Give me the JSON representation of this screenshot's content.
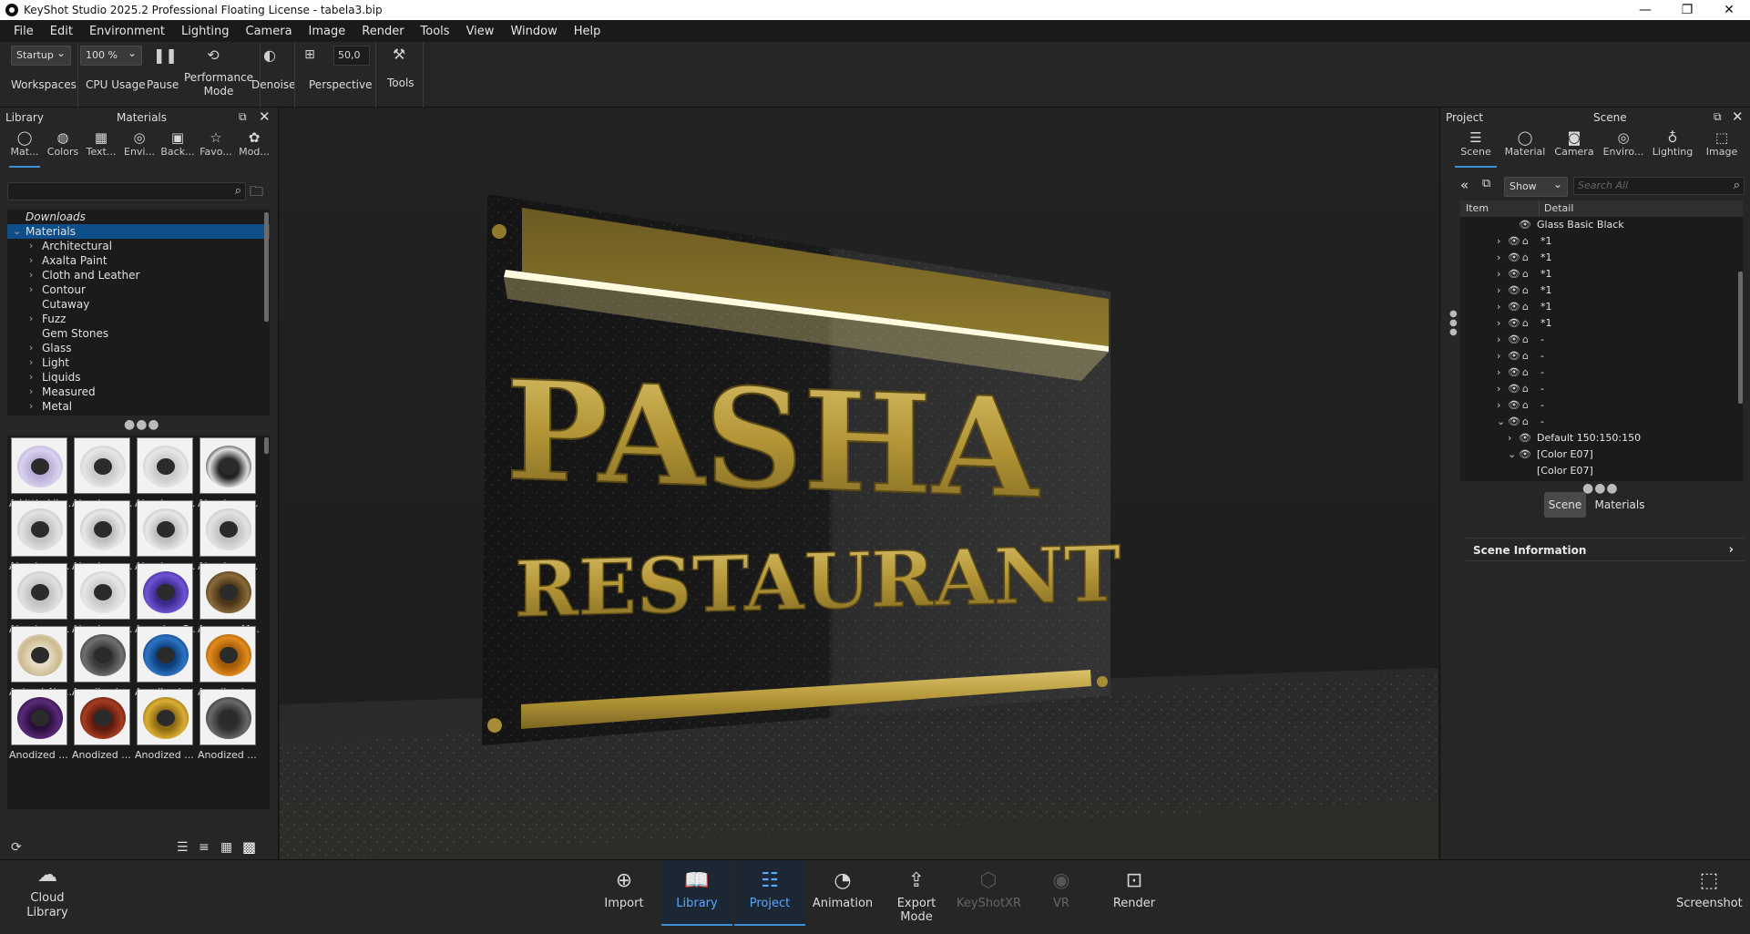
{
  "window": {
    "title": "KeyShot Studio 2025.2 Professional Floating License  - tabela3.bip",
    "controls": [
      "minimize-icon",
      "maximize-icon",
      "close-icon"
    ]
  },
  "menu": [
    "File",
    "Edit",
    "Environment",
    "Lighting",
    "Camera",
    "Image",
    "Render",
    "Tools",
    "View",
    "Window",
    "Help"
  ],
  "ribbon": {
    "workspace_value": "Startup",
    "workspace_label": "Workspaces",
    "cpu_value": "100 %",
    "cpu_label": "CPU Usage",
    "pause_label": "Pause",
    "performance_label_1": "Performance",
    "performance_label_2": "Mode",
    "denoise_label": "Denoise",
    "fov_value": "50,0",
    "perspective_label": "Perspective",
    "tools_label": "Tools"
  },
  "library": {
    "title": "Library",
    "subtitle": "Materials",
    "tabs": [
      {
        "label": "Mat...",
        "icon": "material-icon"
      },
      {
        "label": "Colors",
        "icon": "colors-icon"
      },
      {
        "label": "Text...",
        "icon": "texture-icon"
      },
      {
        "label": "Envi...",
        "icon": "environment-icon"
      },
      {
        "label": "Back...",
        "icon": "backplate-icon"
      },
      {
        "label": "Favo...",
        "icon": "favorites-icon"
      },
      {
        "label": "Mod...",
        "icon": "models-icon"
      }
    ],
    "tree": [
      {
        "label": "Downloads",
        "type": "downloads"
      },
      {
        "label": "Materials",
        "type": "root"
      },
      {
        "label": "Architectural",
        "expand": true
      },
      {
        "label": "Axalta Paint",
        "expand": true
      },
      {
        "label": "Cloth and Leather",
        "expand": true
      },
      {
        "label": "Contour",
        "expand": true
      },
      {
        "label": "Cutaway",
        "expand": false
      },
      {
        "label": "Fuzz",
        "expand": true
      },
      {
        "label": "Gem Stones",
        "expand": false
      },
      {
        "label": "Glass",
        "expand": true
      },
      {
        "label": "Light",
        "expand": true
      },
      {
        "label": "Liquids",
        "expand": true
      },
      {
        "label": "Measured",
        "expand": true
      },
      {
        "label": "Metal",
        "expand": true
      }
    ],
    "materials": [
      {
        "label": "A Little Lila...",
        "color": "#b9aed6",
        "ring": "#d9d2ee"
      },
      {
        "label": "Aluminum...",
        "color": "#c9c9c9",
        "ring": "#e6e6e6"
      },
      {
        "label": "Aluminum...",
        "color": "#c9c9c9",
        "ring": "#e6e6e6"
      },
      {
        "label": "Aluminum...",
        "color": "#222222",
        "ring": "#dedede"
      },
      {
        "label": "Aluminum...",
        "color": "#c2c2c2",
        "ring": "#e2e2e2"
      },
      {
        "label": "Aluminum...",
        "color": "#bdbdbd",
        "ring": "#e8e8e8"
      },
      {
        "label": "Aluminum...",
        "color": "#bdbdbd",
        "ring": "#e8e8e8"
      },
      {
        "label": "Aluminum...",
        "color": "#c2c2c2",
        "ring": "#e2e2e2"
      },
      {
        "label": "Aluminum...",
        "color": "#c2c2c2",
        "ring": "#e0e0e0"
      },
      {
        "label": "Aluminum...",
        "color": "#c9c9c9",
        "ring": "#e6e6e6"
      },
      {
        "label": "Amazing G...",
        "color": "#3b2a8c",
        "ring": "#6f54d6"
      },
      {
        "label": "Amazon M...",
        "color": "#4a3517",
        "ring": "#8a6b3a"
      },
      {
        "label": "Animal_Na...",
        "color": "#e6dcc4",
        "ring": "#cbb98f"
      },
      {
        "label": "Anodized ...",
        "color": "#3a3a3a",
        "ring": "#707070"
      },
      {
        "label": "Anodized ...",
        "color": "#0b3f7c",
        "ring": "#2f74c4"
      },
      {
        "label": "Anodized ...",
        "color": "#a35a07",
        "ring": "#e08b1d"
      },
      {
        "label": "Anodized ...",
        "color": "#2a0f3a",
        "ring": "#5a2a7a"
      },
      {
        "label": "Anodized ...",
        "color": "#5a1a0e",
        "ring": "#a63c22"
      },
      {
        "label": "Anodized ...",
        "color": "#8c6a12",
        "ring": "#dcae34"
      },
      {
        "label": "Anodized ...",
        "color": "#2f2f2f",
        "ring": "#6a6a6a"
      }
    ]
  },
  "project": {
    "title": "Project",
    "subtitle": "Scene",
    "tabs": [
      {
        "label": "Scene",
        "icon": "scene-list-icon"
      },
      {
        "label": "Material",
        "icon": "material-icon"
      },
      {
        "label": "Camera",
        "icon": "camera-icon"
      },
      {
        "label": "Enviro...",
        "icon": "environment-icon"
      },
      {
        "label": "Lighting",
        "icon": "light-bulb-icon"
      },
      {
        "label": "Image",
        "icon": "image-crop-icon"
      }
    ],
    "show_value": "Show",
    "search_placeholder": "Search All",
    "col_item": "Item",
    "col_detail": "Detail",
    "rows": [
      {
        "label": "Glass Basic Black",
        "indent": 0,
        "arrow": ""
      },
      {
        "label": "*1",
        "indent": 1,
        "arrow": "›"
      },
      {
        "label": "*1",
        "indent": 1,
        "arrow": "›"
      },
      {
        "label": "*1",
        "indent": 1,
        "arrow": "›"
      },
      {
        "label": "*1",
        "indent": 1,
        "arrow": "›"
      },
      {
        "label": "*1",
        "indent": 1,
        "arrow": "›"
      },
      {
        "label": "*1",
        "indent": 1,
        "arrow": "›"
      },
      {
        "label": "-",
        "indent": 1,
        "arrow": "›"
      },
      {
        "label": "-",
        "indent": 1,
        "arrow": "›"
      },
      {
        "label": "-",
        "indent": 1,
        "arrow": "›"
      },
      {
        "label": "-",
        "indent": 1,
        "arrow": "›"
      },
      {
        "label": "-",
        "indent": 1,
        "arrow": "›"
      },
      {
        "label": "-",
        "indent": 1,
        "arrow": "⌄"
      },
      {
        "label": "Default 150:150:150",
        "indent": 2,
        "arrow": "›"
      },
      {
        "label": "[Color E07]",
        "indent": 2,
        "arrow": "⌄"
      },
      {
        "label": "[Color E07]",
        "indent": 3,
        "arrow": ""
      }
    ],
    "btn_scene": "Scene",
    "btn_materials": "Materials",
    "scene_info": "Scene Information"
  },
  "viewport": {
    "sign_line1": "PASHA",
    "sign_line2": "RESTAURANT"
  },
  "bottom": {
    "cloud_1": "Cloud",
    "cloud_2": "Library",
    "import": "Import",
    "library": "Library",
    "project": "Project",
    "animation": "Animation",
    "export_mode": "Export Mode",
    "keyshotxr": "KeyShotXR",
    "vr": "VR",
    "render": "Render",
    "screenshot": "Screenshot"
  },
  "colors": {
    "accent": "#3d8fd6",
    "gold": "#b89a3a"
  }
}
